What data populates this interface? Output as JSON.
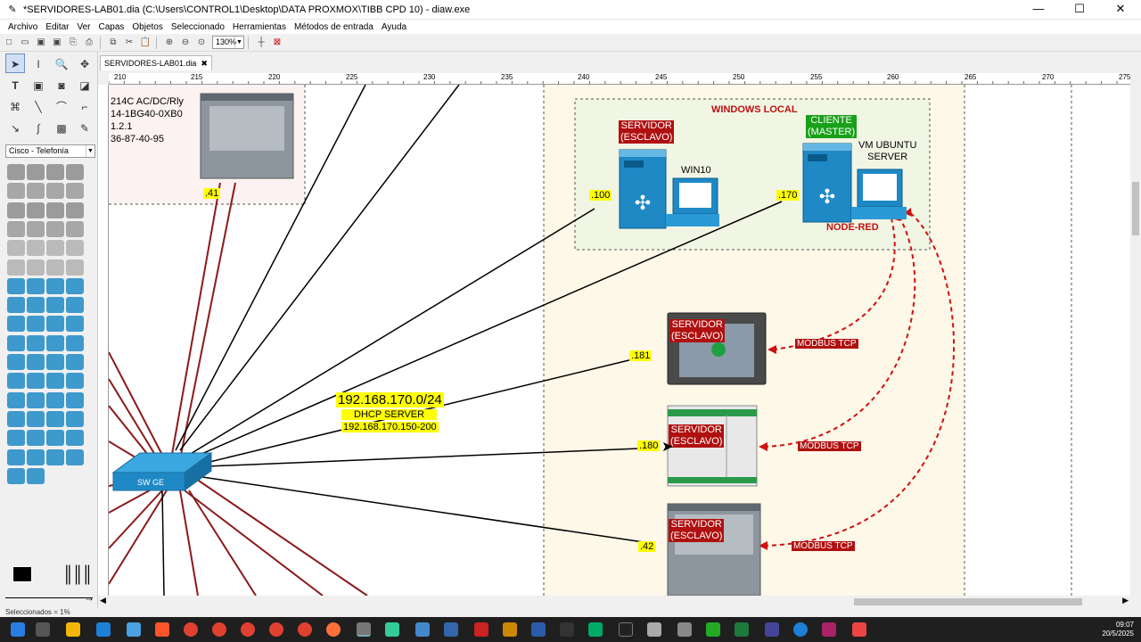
{
  "window": {
    "title": "*SERVIDORES-LAB01.dia (C:\\Users\\CONTROL1\\Desktop\\DATA PROXMOX\\TIBB CPD 10) - diaw.exe",
    "minimize": "—",
    "maximize": "☐",
    "close": "✕"
  },
  "menu": [
    "Archivo",
    "Editar",
    "Ver",
    "Capas",
    "Objetos",
    "Seleccionado",
    "Herramientas",
    "Métodos de entrada",
    "Ayuda"
  ],
  "toolbar": {
    "zoom": "130%"
  },
  "toolbox": {
    "sheet": "Cisco - Telefonía"
  },
  "tab": {
    "label": "SERVIDORES-LAB01.dia",
    "close": "✖"
  },
  "ruler": {
    "ticks": [
      "210",
      "215",
      "220",
      "225",
      "230",
      "235",
      "240",
      "245",
      "250",
      "255",
      "260",
      "265",
      "270",
      "275"
    ]
  },
  "diagram": {
    "plc_text": [
      "214C AC/DC/Rly",
      "14-1BG40-0XB0",
      "1.2.1",
      "36-87-40-95"
    ],
    "plc_ip": ".41",
    "windows_local": "WINDOWS LOCAL",
    "srv1_label": "SERVIDOR\n(ESCLAVO)",
    "srv1_ip": ".100",
    "win10": "WIN10",
    "client_label": "CLIENTE\n(MASTER)",
    "vm_label": "VM UBUNTU\nSERVER",
    "client_ip": ".170",
    "node_red": "NODE-RED",
    "hmi_label": "SERVIDOR\n(ESCLAVO)",
    "hmi_ip": ".181",
    "plc2_label": "SERVIDOR\n(ESCLAVO)",
    "plc2_ip": ".180",
    "plc3_label": "SERVIDOR\n(ESCLAVO)",
    "plc3_ip": ".42",
    "modbus1": "MODBUS TCP",
    "modbus2": "MODBUS TCP",
    "modbus3": "MODBUS TCP",
    "network": "192.168.170.0/24",
    "dhcp": "DHCP SERVER",
    "dhcp_range": "192.168.170.150-200",
    "switch": "SW GE"
  },
  "status": "Seleccionados = 1%",
  "clock": {
    "time": "09:07",
    "date": "20/5/2025"
  }
}
